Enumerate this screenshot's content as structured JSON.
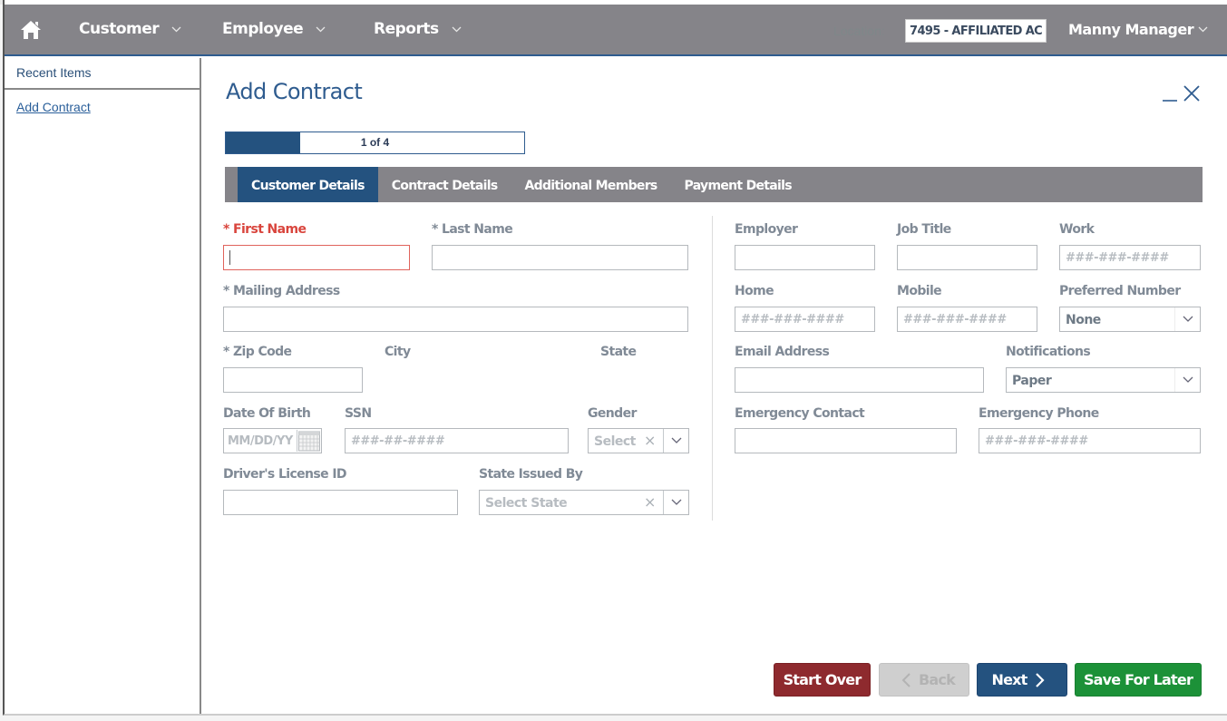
{
  "nav": {
    "home_icon": "home-icon",
    "items": [
      {
        "label": "Customer"
      },
      {
        "label": "Employee"
      },
      {
        "label": "Reports"
      }
    ],
    "location_label": "Location:",
    "location_value": "7495 - AFFILIATED AC",
    "user_name": "Manny Manager"
  },
  "sidebar": {
    "heading": "Recent Items",
    "links": [
      {
        "label": "Add Contract"
      }
    ]
  },
  "page": {
    "title": "Add Contract",
    "minimize_icon": "minimize-icon",
    "close_icon": "close-icon",
    "progress": {
      "text": "1 of 4",
      "current": 1,
      "total": 4,
      "fraction": 0.25
    },
    "tabs": [
      {
        "label": "Customer Details",
        "active": true
      },
      {
        "label": "Contract Details",
        "active": false
      },
      {
        "label": "Additional Members",
        "active": false
      },
      {
        "label": "Payment Details",
        "active": false
      }
    ]
  },
  "form": {
    "first_name": {
      "label": "* First Name",
      "value": ""
    },
    "last_name": {
      "label": "* Last Name",
      "value": ""
    },
    "mailing_address": {
      "label": "* Mailing Address",
      "value": ""
    },
    "zip_code": {
      "label": "* Zip Code",
      "value": ""
    },
    "city": {
      "label": "City"
    },
    "state": {
      "label": "State"
    },
    "dob": {
      "label": "Date Of Birth",
      "placeholder": "MM/DD/YY"
    },
    "ssn": {
      "label": "SSN",
      "placeholder": "###-##-####"
    },
    "gender": {
      "label": "Gender",
      "placeholder": "Select"
    },
    "drivers_license": {
      "label": "Driver's License ID",
      "value": ""
    },
    "state_issued": {
      "label": "State Issued By",
      "placeholder": "Select State"
    },
    "employer": {
      "label": "Employer",
      "value": ""
    },
    "job_title": {
      "label": "Job Title",
      "value": ""
    },
    "work": {
      "label": "Work",
      "placeholder": "###-###-####"
    },
    "home": {
      "label": "Home",
      "placeholder": "###-###-####"
    },
    "mobile": {
      "label": "Mobile",
      "placeholder": "###-###-####"
    },
    "preferred_number": {
      "label": "Preferred Number",
      "value": "None"
    },
    "email": {
      "label": "Email Address",
      "value": ""
    },
    "notifications": {
      "label": "Notifications",
      "value": "Paper"
    },
    "emergency_contact": {
      "label": "Emergency Contact",
      "value": ""
    },
    "emergency_phone": {
      "label": "Emergency Phone",
      "placeholder": "###-###-####"
    }
  },
  "buttons": {
    "start_over": "Start Over",
    "back": "Back",
    "next": "Next",
    "save_for_later": "Save For Later"
  },
  "colors": {
    "nav_bg": "#858489",
    "primary": "#24527f",
    "danger": "#8e2a2e",
    "success": "#1c9138",
    "error": "#d9453d"
  }
}
